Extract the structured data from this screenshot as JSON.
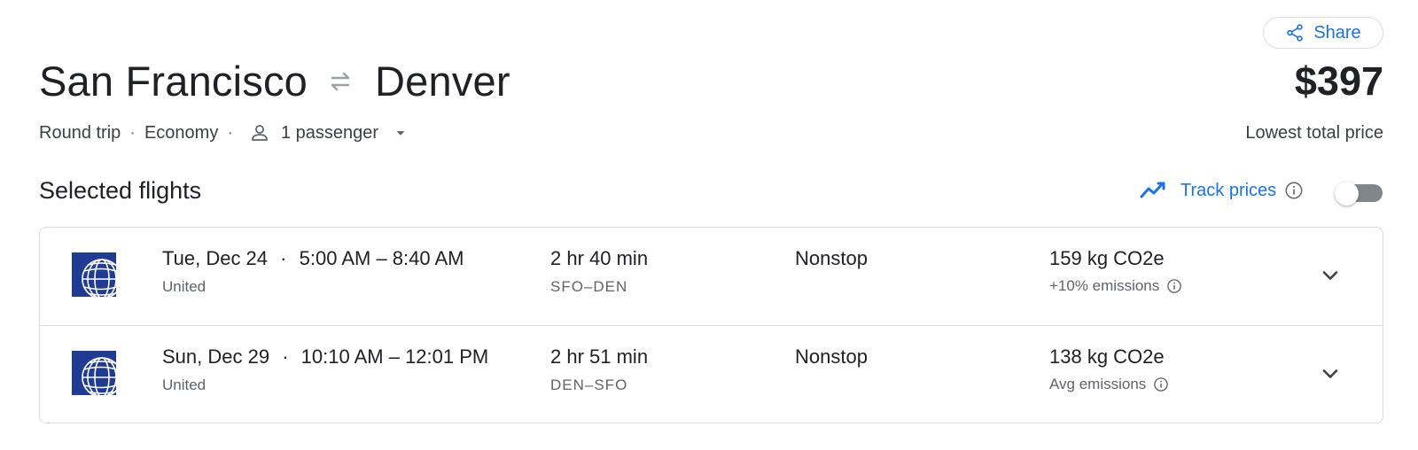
{
  "header": {
    "share_label": "Share",
    "origin": "San Francisco",
    "destination": "Denver",
    "price": "$397",
    "price_caption": "Lowest total price"
  },
  "trip": {
    "type": "Round trip",
    "separator": "·",
    "cabin": "Economy",
    "passengers": "1 passenger"
  },
  "section": {
    "title": "Selected flights",
    "track_label": "Track prices",
    "track_enabled": false
  },
  "flights": [
    {
      "date": "Tue, Dec 24",
      "times": "5:00 AM – 8:40 AM",
      "airline": "United",
      "duration": "2 hr 40 min",
      "route": "SFO–DEN",
      "stops": "Nonstop",
      "co2": "159 kg CO2e",
      "emissions": "+10% emissions"
    },
    {
      "date": "Sun, Dec 29",
      "times": "10:10 AM – 12:01 PM",
      "airline": "United",
      "duration": "2 hr 51 min",
      "route": "DEN–SFO",
      "stops": "Nonstop",
      "co2": "138 kg CO2e",
      "emissions": "Avg emissions"
    }
  ],
  "colors": {
    "accent": "#1a73e8",
    "text": "#202124",
    "muted": "#5f6368",
    "border": "#dadce0",
    "united_blue": "#1f3b94"
  },
  "icons": {
    "share": "share-icon",
    "swap": "swap-arrows-icon",
    "person": "person-icon",
    "dropdown": "caret-down-icon",
    "trend": "trend-icon",
    "info": "info-icon",
    "expand": "chevron-down-icon",
    "airline_logo": "united-logo"
  }
}
